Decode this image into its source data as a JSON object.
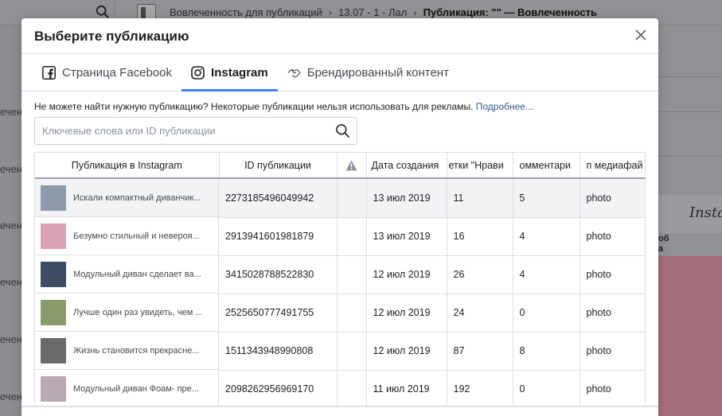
{
  "background": {
    "breadcrumbs": [
      "Вовлеченность для публикаций",
      "13.07 - 1 - Лал"
    ],
    "breadcrumb_current": "Публикация: \"\" — Вовлеченность",
    "side_labels": [
      "ечень",
      "ечень",
      "ечень",
      "ечень",
      "ечень",
      "ечень"
    ],
    "right_brand": "Insta",
    "right_text_1": "об",
    "right_text_2": "а"
  },
  "modal": {
    "title": "Выберите публикацию",
    "tabs": [
      {
        "label": "Страница Facebook",
        "icon": "facebook-icon",
        "active": false
      },
      {
        "label": "Instagram",
        "icon": "instagram-icon",
        "active": true
      },
      {
        "label": "Брендированный контент",
        "icon": "handshake-icon",
        "active": false
      }
    ],
    "info_text": "Не можете найти нужную публикацию? Некоторые публикации нельзя использовать для рекламы.",
    "info_link": "Подробнее...",
    "search": {
      "placeholder": "Ключевые слова или ID публикации",
      "value": ""
    },
    "table": {
      "columns": [
        "Публикация в Instagram",
        "ID публикации",
        "warning-icon",
        "Дата создания",
        "етки \"Нрави",
        "омментари",
        "п медиафай"
      ],
      "rows": [
        {
          "post": "Искали компактный диванчик...",
          "id": "2273185496049942",
          "warn": "",
          "date": "13 июл 2019",
          "likes": "11",
          "comments": "5",
          "media": "photo",
          "thumb": "#8e9ba8",
          "selected": true
        },
        {
          "post": "Безумно стильный и невероя...",
          "id": "2913941601981879",
          "warn": "",
          "date": "13 июл 2019",
          "likes": "16",
          "comments": "4",
          "media": "photo",
          "thumb": "#d8a2b5",
          "selected": false
        },
        {
          "post": "Модульный диван сделает ва...",
          "id": "3415028788522830",
          "warn": "",
          "date": "12 июл 2019",
          "likes": "26",
          "comments": "4",
          "media": "photo",
          "thumb": "#3d4b63",
          "selected": false
        },
        {
          "post": "Лучше один раз увидеть, чем ...",
          "id": "2525650777491755",
          "warn": "",
          "date": "12 июл 2019",
          "likes": "24",
          "comments": "0",
          "media": "photo",
          "thumb": "#8b9a6a",
          "selected": false
        },
        {
          "post": "Жизнь становится прекрасне...",
          "id": "1511343948990808",
          "warn": "",
          "date": "12 июл 2019",
          "likes": "87",
          "comments": "8",
          "media": "photo",
          "thumb": "#6d6a6b",
          "selected": false
        },
        {
          "post": "Модульный диван Фоам- пре...",
          "id": "2098262956969170",
          "warn": "",
          "date": "11 июл 2019",
          "likes": "192",
          "comments": "0",
          "media": "photo",
          "thumb": "#b9a9b3",
          "selected": false
        }
      ]
    }
  },
  "colors": {
    "accent": "#4080ff",
    "link": "#385898"
  }
}
